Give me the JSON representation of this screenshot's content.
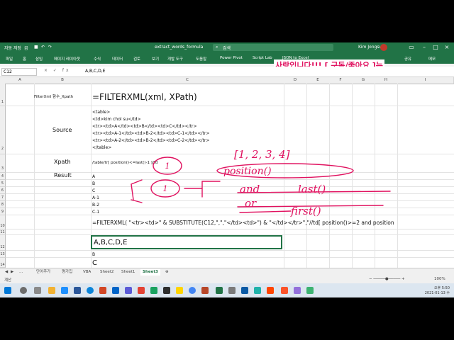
{
  "window": {
    "autosave_label": "자동 저장",
    "autosave_state": "끔",
    "file_title": "extract_words_formula",
    "search_placeholder": "검색",
    "user_name": "Kim Jongsu"
  },
  "menu": {
    "items": [
      "파일",
      "홈",
      "삽입",
      "페이지 레이아웃",
      "수식",
      "데이터",
      "검토",
      "보기",
      "개발 도구",
      "도움말",
      "Power Pivot",
      "Script Lab",
      "JSON to Excel"
    ],
    "share_label": "공유",
    "memo_label": "메모"
  },
  "promo_text": "사랑입니다!!!   [  구독/좋아요 ]는",
  "formula_bar": {
    "name_box": "C12",
    "icons": "× ✓ fx",
    "value": "A,B,C,D,E"
  },
  "columns": [
    "A",
    "B",
    "C",
    "D",
    "E",
    "F",
    "G",
    "H",
    "I"
  ],
  "rows": [
    "1",
    "2",
    "3",
    "4",
    "5",
    "6",
    "7",
    "8",
    "9",
    "10",
    "11",
    "12",
    "13",
    "14"
  ],
  "cells": {
    "b1": "FilterXml 함수_Xpath",
    "c1": "=FILTERXML(xml, XPath)",
    "b2": "Source",
    "c2_lines": [
      "<table>",
      "<td>kim chol su</td>",
      "<tr><td>A</td><td>B</td><td>C</td></tr>",
      "<tr><td>A-1</td><td>B-2</td><td>C-1</td></tr>",
      "<tr><td>A-2</td><td>B-2</td><td>C-2</td></tr>",
      "</table>"
    ],
    "b3": "Xpath",
    "c3": "/table/tr[ position()<=last()-1 ]/td",
    "b4": "Result",
    "results": [
      "A",
      "B",
      "C",
      "A-1",
      "B-2",
      "C-1"
    ],
    "c10": "=FILTERXML( \"<tr><td>\" & SUBSTITUTE(C12,\",\",\"</td><td>\") & \"</td></tr>\",\"//td[ position()>=2 and position",
    "c12": "A,B,C,D,E",
    "c13": "B",
    "c14": "C"
  },
  "annotations": {
    "top": "[1, 2, 3, 4]",
    "position": "position()",
    "and": "and",
    "last": "last()",
    "or": "or",
    "first": "first()",
    "circle_1": "1",
    "circle_2": "1"
  },
  "sheet_tabs": {
    "items": [
      "단어추가",
      "평가집",
      "VBA",
      "Sheet2",
      "Sheet1",
      "Sheet3"
    ],
    "active": "Sheet3"
  },
  "status": {
    "ready": "계산",
    "zoom": "100%"
  },
  "taskbar": {
    "clock_time": "오후 5:50",
    "clock_date": "2021-01-13 수"
  },
  "colors": {
    "excel_green": "#217346",
    "promo": "#e0115f",
    "ink": "#e0115f"
  }
}
